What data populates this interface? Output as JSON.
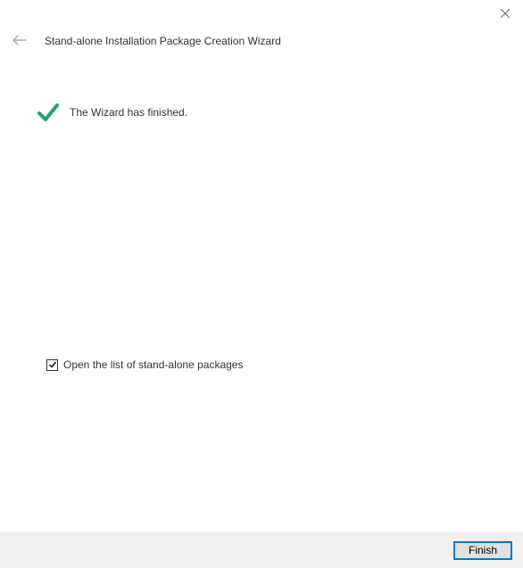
{
  "header": {
    "title": "Stand-alone Installation Package Creation Wizard"
  },
  "status": {
    "message": "The Wizard has finished."
  },
  "option": {
    "label": "Open the list of stand-alone packages",
    "checked": true
  },
  "footer": {
    "finish_label": "Finish"
  }
}
